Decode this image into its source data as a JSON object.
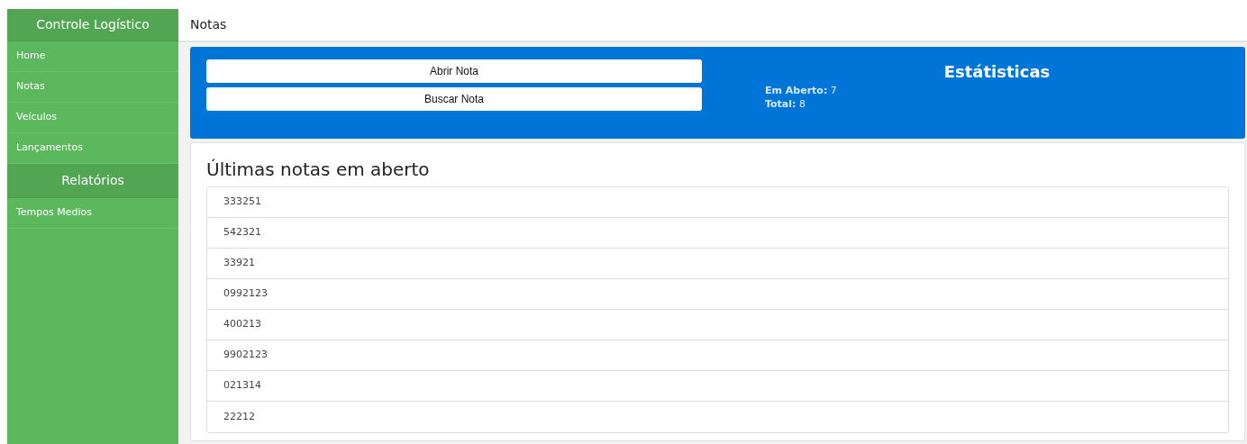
{
  "sidebar": {
    "title": "Controle Logístico",
    "items": [
      {
        "kind": "link",
        "label": "Home"
      },
      {
        "kind": "link",
        "label": "Notas"
      },
      {
        "kind": "link",
        "label": "Veículos"
      },
      {
        "kind": "link",
        "label": "Lançamentos"
      },
      {
        "kind": "section",
        "label": "Relatórios"
      },
      {
        "kind": "link",
        "label": "Tempos Medios"
      }
    ]
  },
  "header": {
    "title": "Notas"
  },
  "actions": [
    "Abrir Nota",
    "Buscar Nota"
  ],
  "stats": {
    "title": "Estátisticas",
    "lines": [
      "**Em Aberto:** 7",
      "**Total:** 8"
    ]
  },
  "open_notes": {
    "title": "Últimas notas em aberto",
    "items": [
      "333251",
      "542321",
      "33921",
      "0992123",
      "400213",
      "9902123",
      "021314",
      "22212"
    ]
  }
}
